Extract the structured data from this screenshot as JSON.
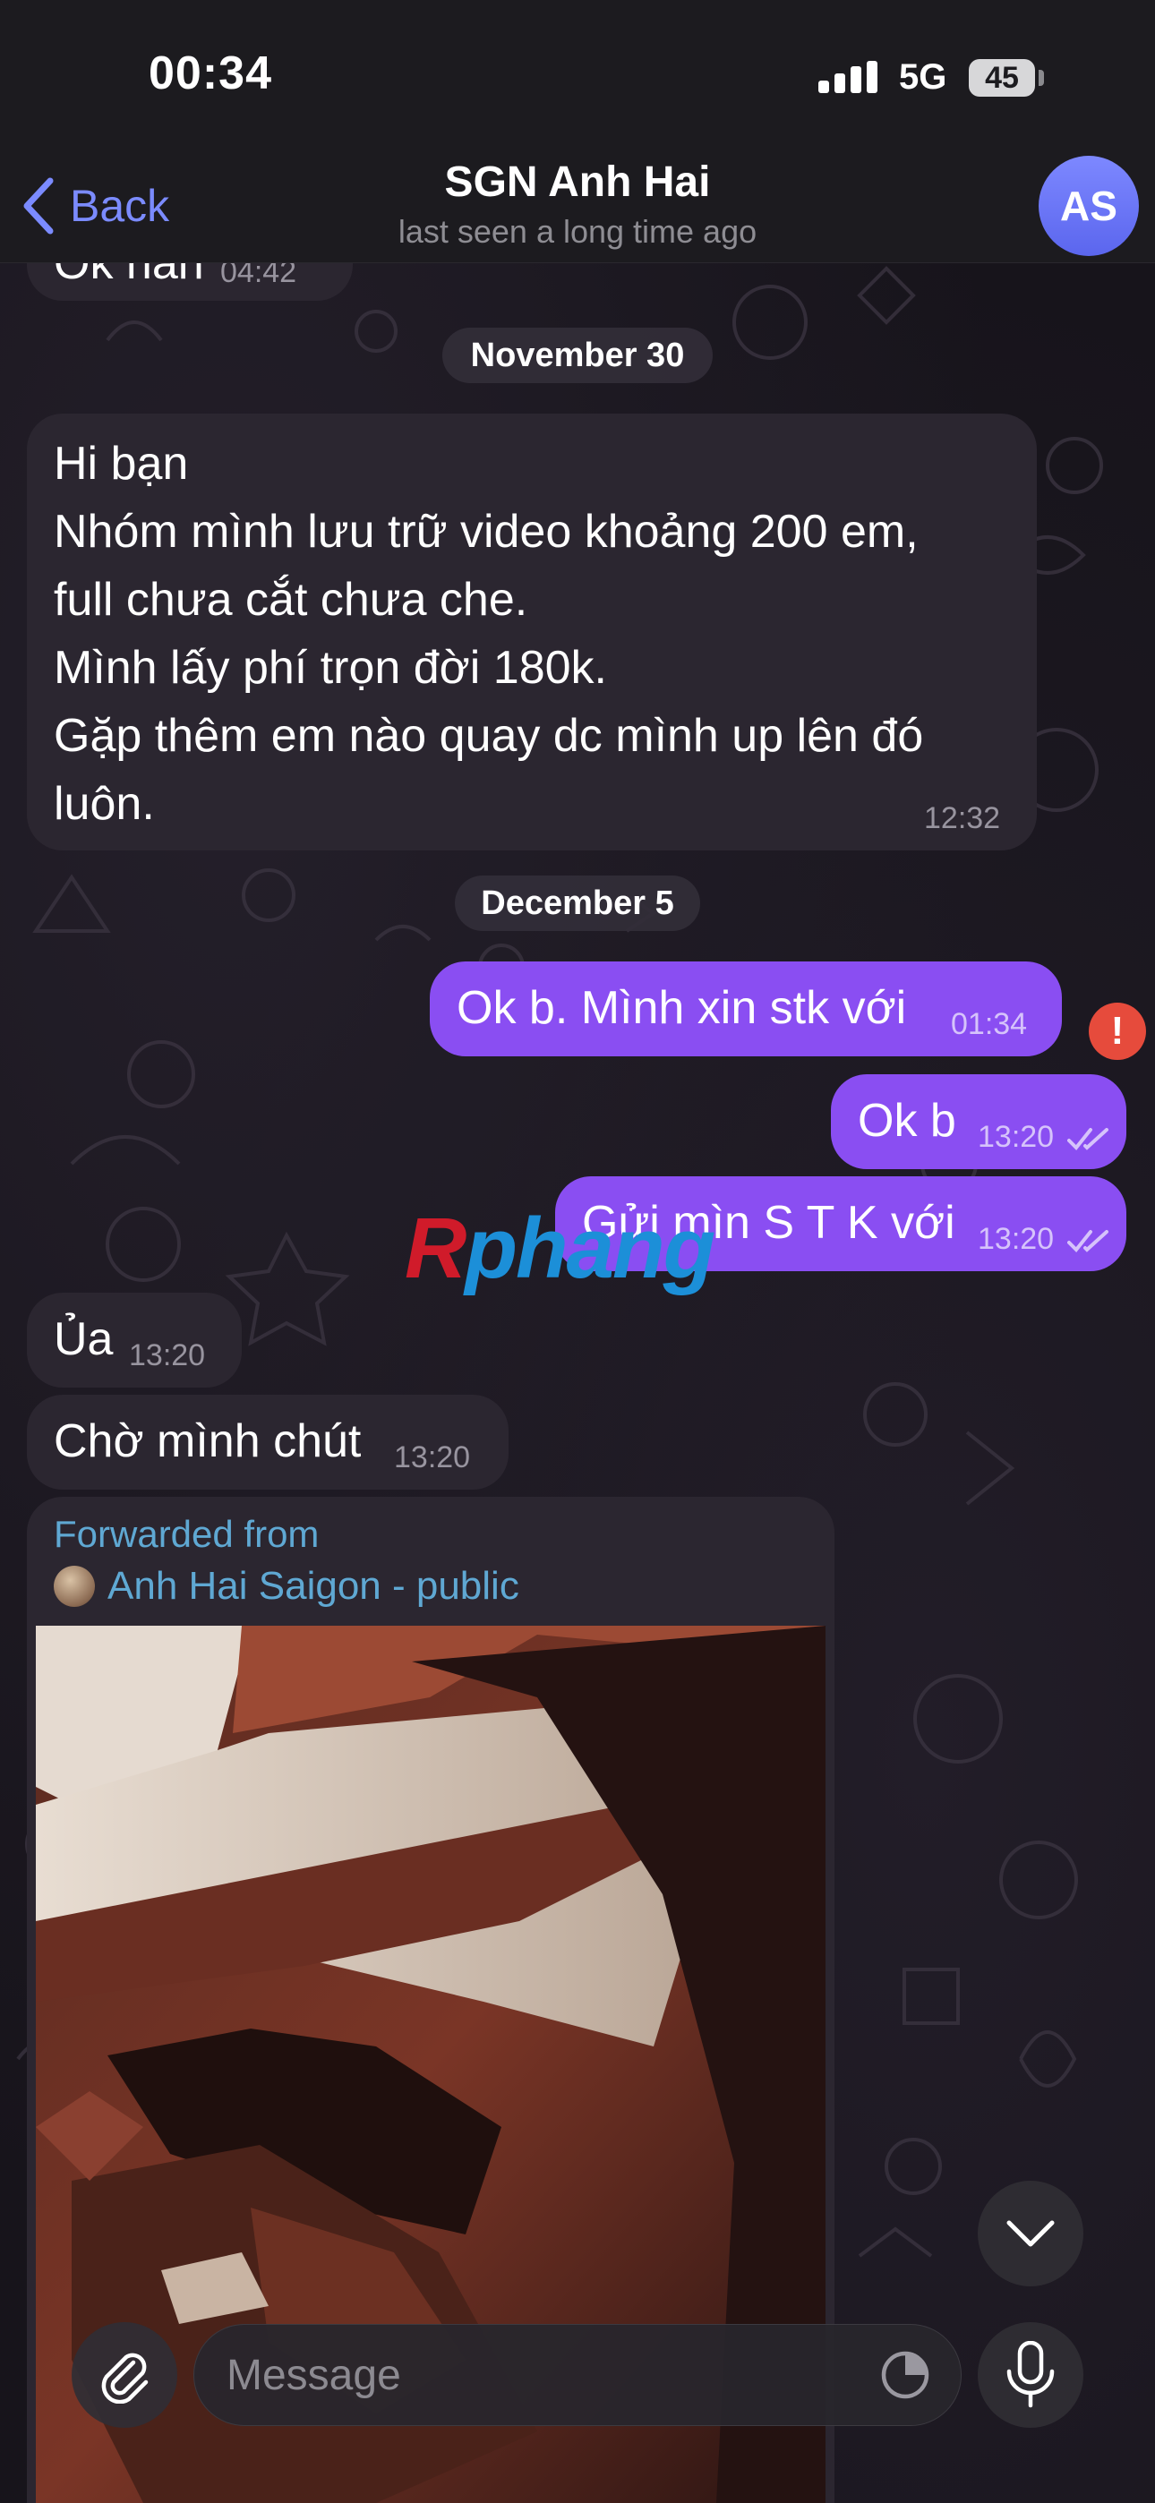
{
  "status_bar": {
    "time": "00:34",
    "network": "5G",
    "battery": "45"
  },
  "header": {
    "back_label": "Back",
    "title": "SGN Anh Hai",
    "subtitle": "last seen a long time ago",
    "avatar_initials": "AS"
  },
  "messages": {
    "cut_top": {
      "text": "Ok nah",
      "time": "04:42"
    },
    "date_1": "November 30",
    "m1": {
      "text": "Hi bạn\nNhóm mình lưu trữ video khoảng 200 em,\nfull chưa cắt chưa che.\nMình lấy phí trọn đời 180k.\nGặp thêm em nào quay dc mình up lên đó\nluôn.",
      "time": "12:32"
    },
    "date_2": "December 5",
    "m2": {
      "text": "Ok b. Mình xin stk với",
      "time": "01:34",
      "error": "!"
    },
    "m3": {
      "text": "Ok b",
      "time": "13:20"
    },
    "m4": {
      "text": "Gửi mìn S T K với",
      "time": "13:20"
    },
    "m5": {
      "text": "Ủa",
      "time": "13:20"
    },
    "m6": {
      "text": "Chờ mình chút",
      "time": "13:20"
    }
  },
  "watermark": {
    "first_letter": "R",
    "rest": "phang"
  },
  "forwarded": {
    "label": "Forwarded from",
    "source": "Anh Hai Saigon - public"
  },
  "composer": {
    "placeholder": "Message"
  },
  "icons": {
    "back": "chevron-left-icon",
    "attach": "paperclip-icon",
    "sticker": "sticker-clock-icon",
    "mic": "microphone-icon",
    "scroll": "chevron-down-icon"
  },
  "colors": {
    "accent": "#7b8bff",
    "outgoing_bubble": "#8a4ef2",
    "incoming_bubble": "#2b2630",
    "error": "#e64b3c",
    "link": "#5fa8d3"
  }
}
